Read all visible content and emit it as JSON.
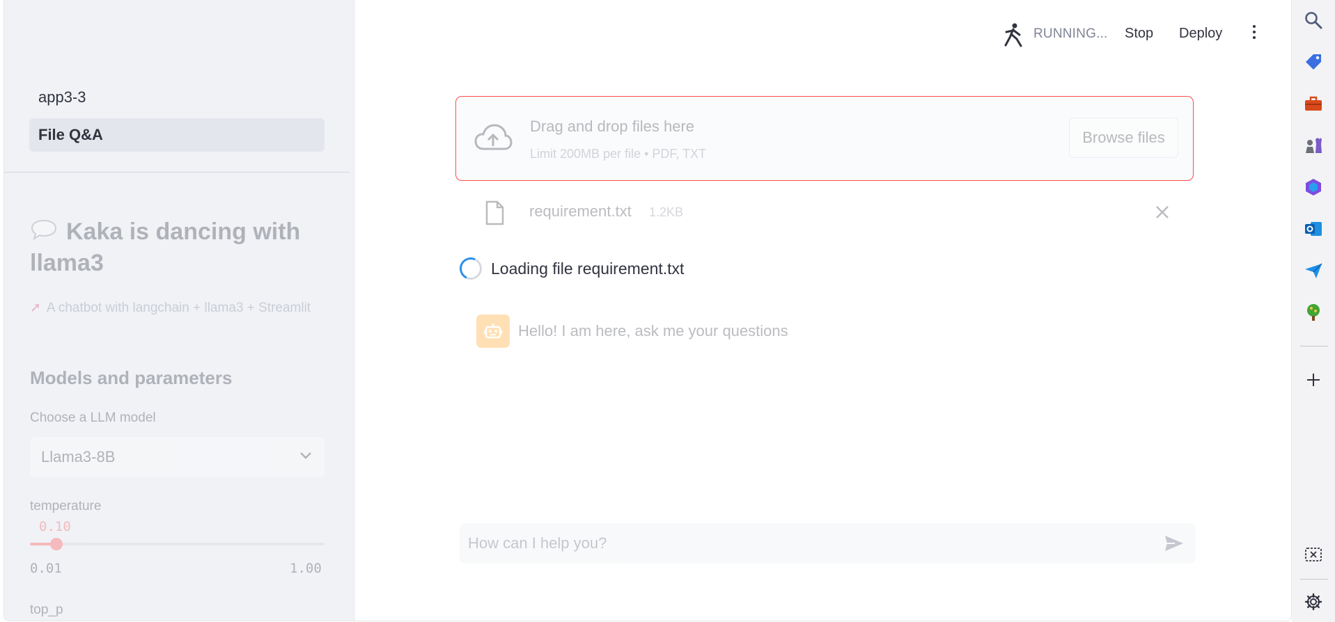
{
  "sidebar": {
    "nav": [
      {
        "label": "app3-3"
      },
      {
        "label": "File Q&A"
      }
    ],
    "title": "Kaka is dancing with llama3",
    "caption": "A chatbot with langchain + llama3 + Streamlit",
    "models_heading": "Models and parameters",
    "model_label": "Choose a LLM model",
    "model_value": "Llama3-8B",
    "temperature": {
      "label": "temperature",
      "value": "0.10",
      "min": "0.01",
      "max": "1.00",
      "fraction": 0.091
    },
    "top_p_label": "top_p"
  },
  "header": {
    "status": "RUNNING...",
    "stop": "Stop",
    "deploy": "Deploy"
  },
  "uploader": {
    "title": "Drag and drop files here",
    "limit": "Limit 200MB per file • PDF, TXT",
    "browse": "Browse files"
  },
  "file": {
    "name": "requirement.txt",
    "size": "1.2KB"
  },
  "loading": "Loading file requirement.txt",
  "chat": {
    "message": "Hello! I am here, ask me your questions",
    "input_placeholder": "How can I help you?"
  },
  "colors": {
    "accent": "#ff4b4b",
    "sidebar_bg": "#f0f2f6",
    "avatar": "#ffa421",
    "spinner": "#2b8ee8"
  },
  "rail_icons": [
    "search-icon",
    "tag-icon",
    "toolbox-icon",
    "chess-icon",
    "copilot-icon",
    "outlook-icon",
    "send-icon",
    "tree-icon",
    "add-icon",
    "screenshot-icon",
    "settings-icon"
  ]
}
